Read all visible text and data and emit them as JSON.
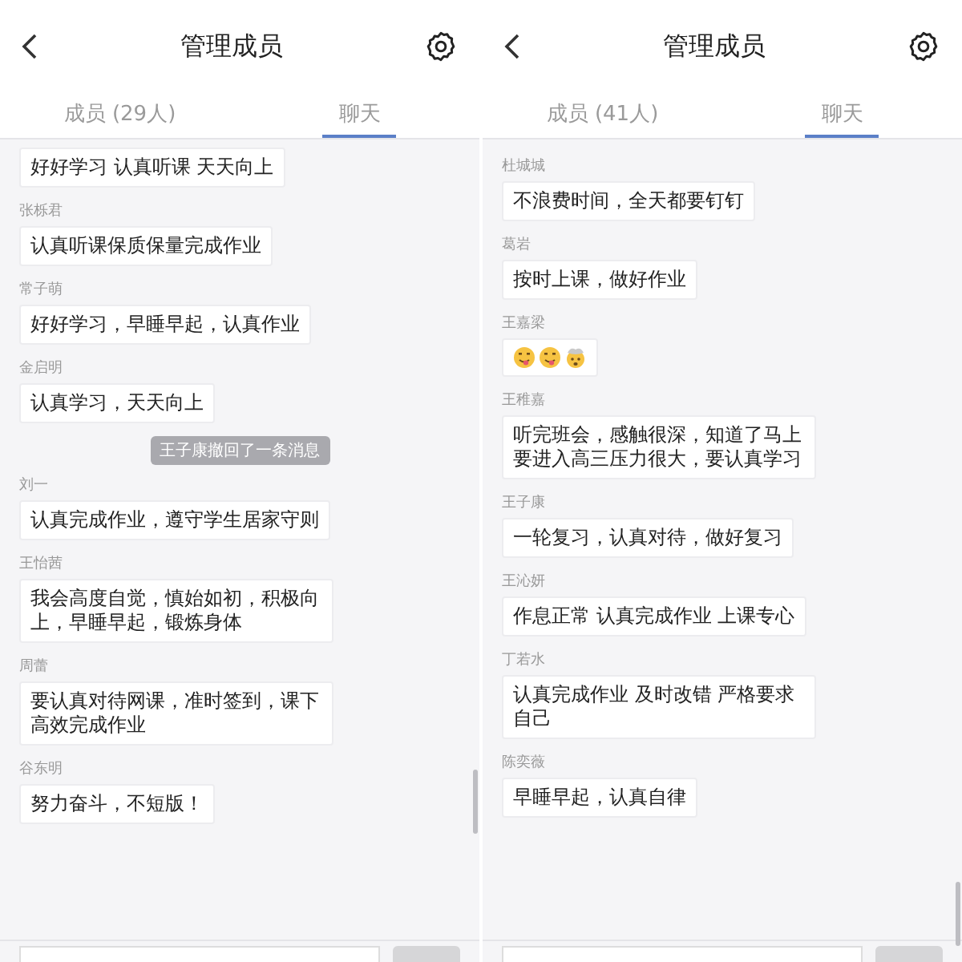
{
  "screens": [
    {
      "title": "管理成员",
      "tabs": [
        {
          "label": "成员 (29人)",
          "selected": false
        },
        {
          "label": "聊天",
          "selected": true
        }
      ],
      "messages": [
        {
          "kind": "text",
          "text": "好好学习 认真听课 天天向上"
        },
        {
          "kind": "text",
          "sender": "张栎君",
          "text": "认真听课保质保量完成作业"
        },
        {
          "kind": "text",
          "sender": "常子萌",
          "text": "好好学习，早睡早起，认真作业"
        },
        {
          "kind": "text",
          "sender": "金启明",
          "text": "认真学习，天天向上"
        },
        {
          "kind": "notice",
          "text": "王子康撤回了一条消息"
        },
        {
          "kind": "text",
          "sender": "刘一",
          "text": "认真完成作业，遵守学生居家守则"
        },
        {
          "kind": "text",
          "sender": "王怡茜",
          "text": "我会高度自觉，慎始如初，积极向上，早睡早起，锻炼身体"
        },
        {
          "kind": "text",
          "sender": "周蕾",
          "text": "要认真对待网课，准时签到，课下高效完成作业"
        },
        {
          "kind": "text",
          "sender": "谷东明",
          "text": "努力奋斗，不短版！"
        }
      ]
    },
    {
      "title": "管理成员",
      "tabs": [
        {
          "label": "成员 (41人)",
          "selected": false
        },
        {
          "label": "聊天",
          "selected": true
        }
      ],
      "messages": [
        {
          "kind": "text",
          "sender": "杜城城",
          "text": "不浪费时间，全天都要钉钉"
        },
        {
          "kind": "text",
          "sender": "葛岩",
          "text": "按时上课，做好作业"
        },
        {
          "kind": "stickers",
          "sender": "王嘉梁",
          "stickers": [
            {
              "kind": "tongue"
            },
            {
              "kind": "tongue"
            },
            {
              "kind": "mind-blown"
            }
          ]
        },
        {
          "kind": "text",
          "sender": "王稚嘉",
          "text": "听完班会，感触很深，知道了马上要进入高三压力很大，要认真学习"
        },
        {
          "kind": "text",
          "sender": "王子康",
          "text": "一轮复习，认真对待，做好复习"
        },
        {
          "kind": "text",
          "sender": "王沁妍",
          "text": "作息正常 认真完成作业 上课专心"
        },
        {
          "kind": "text",
          "sender": "丁若水",
          "text": "认真完成作业 及时改错 严格要求自己"
        },
        {
          "kind": "text",
          "sender": "陈奕薇",
          "text": "早睡早起，认真自律"
        }
      ]
    }
  ]
}
